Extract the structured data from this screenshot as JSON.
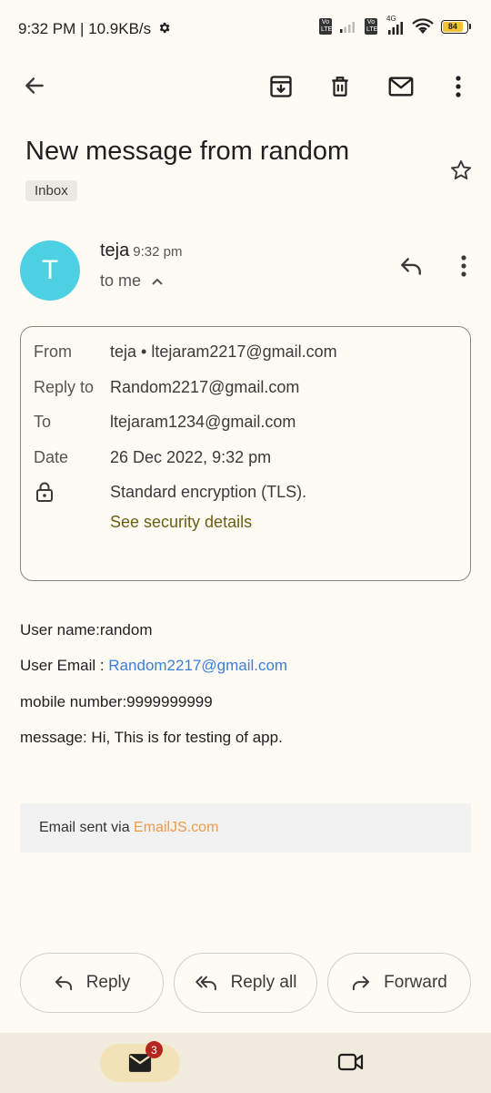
{
  "status_bar": {
    "time": "9:32 PM | 10.9KB/s",
    "volte_label": "Vo LTE",
    "network_label": "4G",
    "battery": "84"
  },
  "toolbar": {
    "icons": [
      "back-arrow-icon",
      "archive-icon",
      "delete-icon",
      "mark-unread-icon",
      "more-vert-icon"
    ]
  },
  "message": {
    "subject": "New message from random",
    "label": "Inbox",
    "avatar_letter": "T",
    "sender_name": "teja",
    "time": "9:32 pm",
    "to_line": "to me"
  },
  "details": {
    "from_label": "From",
    "from_value": "teja • ltejaram2217@gmail.com",
    "reply_to_label": "Reply to",
    "reply_to_value": "Random2217@gmail.com",
    "to_label": "To",
    "to_value": "ltejaram1234@gmail.com",
    "date_label": "Date",
    "date_value": "26 Dec 2022, 9:32 pm",
    "encryption_value": "Standard encryption (TLS).",
    "security_link": "See security details"
  },
  "body": {
    "line1": "User name:random",
    "line2_label": "User Email : ",
    "line2_link": "Random2217@gmail.com",
    "line3": "mobile number:9999999999",
    "line4": "message: Hi, This is for testing of app."
  },
  "footer": {
    "text": "Email sent via ",
    "link": "EmailJS.com"
  },
  "actions": {
    "reply": "Reply",
    "reply_all": "Reply all",
    "forward": "Forward"
  },
  "bottom_nav": {
    "mail_badge": "3"
  },
  "colors": {
    "background": "#fefbf5",
    "avatar": "#4dd0e1",
    "link_blue": "#3b7dd8",
    "emailjs_orange": "#f19a4a",
    "security_link": "#6b5e12",
    "badge": "#b3261e",
    "active_nav": "#f2e2b7"
  }
}
